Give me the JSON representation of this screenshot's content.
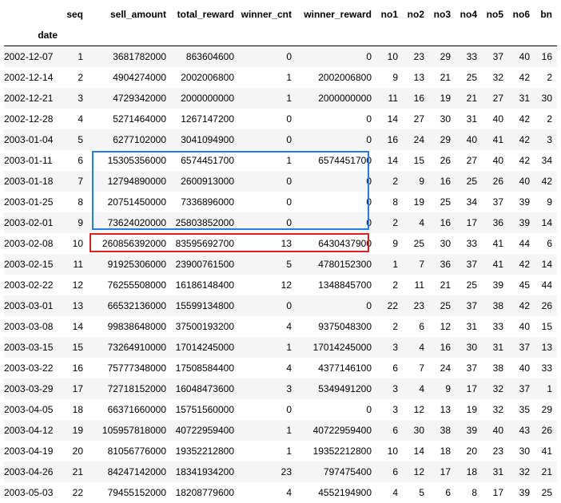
{
  "columns": [
    "seq",
    "sell_amount",
    "total_reward",
    "winner_cnt",
    "winner_reward",
    "no1",
    "no2",
    "no3",
    "no4",
    "no5",
    "no6",
    "bn"
  ],
  "index_name": "date",
  "rows": [
    [
      "2002-12-07",
      "1",
      "3681782000",
      "863604600",
      "0",
      "0",
      "10",
      "23",
      "29",
      "33",
      "37",
      "40",
      "16"
    ],
    [
      "2002-12-14",
      "2",
      "4904274000",
      "2002006800",
      "1",
      "2002006800",
      "9",
      "13",
      "21",
      "25",
      "32",
      "42",
      "2"
    ],
    [
      "2002-12-21",
      "3",
      "4729342000",
      "2000000000",
      "1",
      "2000000000",
      "11",
      "16",
      "19",
      "21",
      "27",
      "31",
      "30"
    ],
    [
      "2002-12-28",
      "4",
      "5271464000",
      "1267147200",
      "0",
      "0",
      "14",
      "27",
      "30",
      "31",
      "40",
      "42",
      "2"
    ],
    [
      "2003-01-04",
      "5",
      "6277102000",
      "3041094900",
      "0",
      "0",
      "16",
      "24",
      "29",
      "40",
      "41",
      "42",
      "3"
    ],
    [
      "2003-01-11",
      "6",
      "15305356000",
      "6574451700",
      "1",
      "6574451700",
      "14",
      "15",
      "26",
      "27",
      "40",
      "42",
      "34"
    ],
    [
      "2003-01-18",
      "7",
      "12794890000",
      "2600913000",
      "0",
      "0",
      "2",
      "9",
      "16",
      "25",
      "26",
      "40",
      "42"
    ],
    [
      "2003-01-25",
      "8",
      "20751450000",
      "7336896000",
      "0",
      "0",
      "8",
      "19",
      "25",
      "34",
      "37",
      "39",
      "9"
    ],
    [
      "2003-02-01",
      "9",
      "73624020000",
      "25803852000",
      "0",
      "0",
      "2",
      "4",
      "16",
      "17",
      "36",
      "39",
      "14"
    ],
    [
      "2003-02-08",
      "10",
      "260856392000",
      "83595692700",
      "13",
      "6430437900",
      "9",
      "25",
      "30",
      "33",
      "41",
      "44",
      "6"
    ],
    [
      "2003-02-15",
      "11",
      "91925306000",
      "23900761500",
      "5",
      "4780152300",
      "1",
      "7",
      "36",
      "37",
      "41",
      "42",
      "14"
    ],
    [
      "2003-02-22",
      "12",
      "76255508000",
      "16186148400",
      "12",
      "1348845700",
      "2",
      "11",
      "21",
      "25",
      "39",
      "45",
      "44"
    ],
    [
      "2003-03-01",
      "13",
      "66532136000",
      "15599134800",
      "0",
      "0",
      "22",
      "23",
      "25",
      "37",
      "38",
      "42",
      "26"
    ],
    [
      "2003-03-08",
      "14",
      "99838648000",
      "37500193200",
      "4",
      "9375048300",
      "2",
      "6",
      "12",
      "31",
      "33",
      "40",
      "15"
    ],
    [
      "2003-03-15",
      "15",
      "73264910000",
      "17014245000",
      "1",
      "17014245000",
      "3",
      "4",
      "16",
      "30",
      "31",
      "37",
      "13"
    ],
    [
      "2003-03-22",
      "16",
      "75777348000",
      "17508584400",
      "4",
      "4377146100",
      "6",
      "7",
      "24",
      "37",
      "38",
      "40",
      "33"
    ],
    [
      "2003-03-29",
      "17",
      "72718152000",
      "16048473600",
      "3",
      "5349491200",
      "3",
      "4",
      "9",
      "17",
      "32",
      "37",
      "1"
    ],
    [
      "2003-04-05",
      "18",
      "66371660000",
      "15751560000",
      "0",
      "0",
      "3",
      "12",
      "13",
      "19",
      "32",
      "35",
      "29"
    ],
    [
      "2003-04-12",
      "19",
      "105957818000",
      "40722959400",
      "1",
      "40722959400",
      "6",
      "30",
      "38",
      "39",
      "40",
      "43",
      "26"
    ],
    [
      "2003-04-19",
      "20",
      "81056776000",
      "19352212800",
      "1",
      "19352212800",
      "10",
      "14",
      "18",
      "20",
      "23",
      "30",
      "41"
    ],
    [
      "2003-04-26",
      "21",
      "84247142000",
      "18341934200",
      "23",
      "797475400",
      "6",
      "12",
      "17",
      "18",
      "31",
      "32",
      "21"
    ],
    [
      "2003-05-03",
      "22",
      "79455152000",
      "18208779600",
      "4",
      "4552194900",
      "4",
      "5",
      "6",
      "8",
      "17",
      "39",
      "25"
    ]
  ],
  "highlights": [
    {
      "color": "#1f7fe6",
      "label": "blue-box"
    },
    {
      "color": "#e02020",
      "label": "red-box"
    }
  ]
}
